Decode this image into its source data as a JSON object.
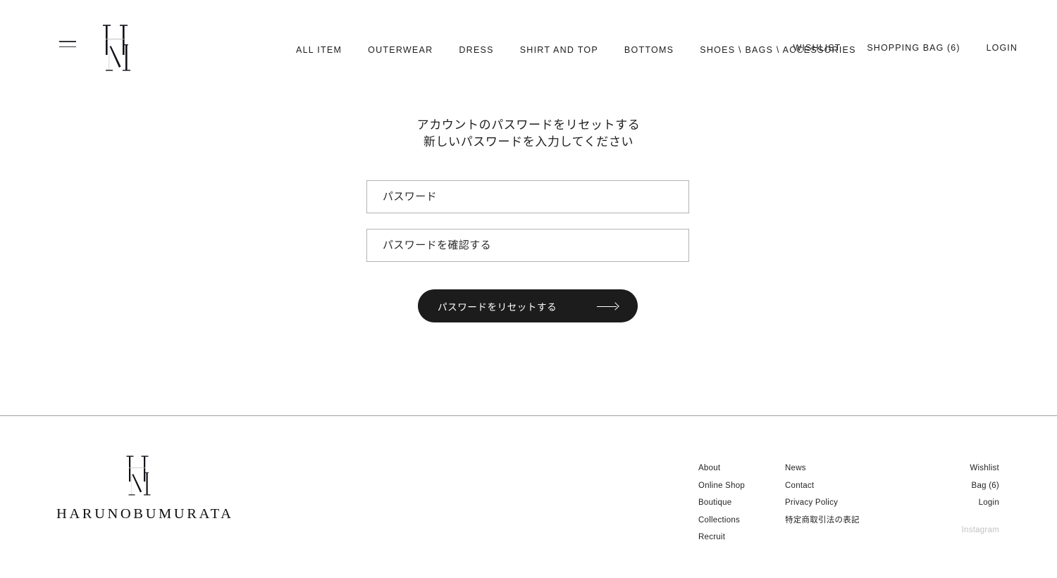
{
  "header": {
    "menu_icon": "hamburger-menu-icon",
    "logo_mark": "hm-monogram-logo",
    "nav": [
      {
        "label": "ALL ITEM",
        "name": "nav-all-item"
      },
      {
        "label": "OUTERWEAR",
        "name": "nav-outerwear"
      },
      {
        "label": "DRESS",
        "name": "nav-dress"
      },
      {
        "label": "SHIRT AND TOP",
        "name": "nav-shirt-and-top"
      },
      {
        "label": "BOTTOMS",
        "name": "nav-bottoms"
      },
      {
        "label": "SHOES \\ BAGS \\ ACCESSORIES",
        "name": "nav-shoes-bags-accessories"
      }
    ],
    "utility": [
      {
        "label": "WISHLIST",
        "name": "utility-wishlist"
      },
      {
        "label": "SHOPPING BAG (6)",
        "name": "utility-shopping-bag"
      },
      {
        "label": "LOGIN",
        "name": "utility-login"
      }
    ],
    "bag_count": "6"
  },
  "main": {
    "heading_line_1": "アカウントのパスワードをリセットする",
    "heading_line_2": "新しいパスワードを入力してください",
    "password_placeholder": "パスワード",
    "password_value": "",
    "confirm_placeholder": "パスワードを確認する",
    "confirm_value": "",
    "submit_label": "パスワードをリセットする",
    "submit_icon": "arrow-right-icon"
  },
  "footer": {
    "brand_mark": "hm-monogram-logo",
    "wordmark": "HARUNOBUMURATA",
    "column_1": [
      {
        "label": "About",
        "name": "footer-link-about"
      },
      {
        "label": "Online Shop",
        "name": "footer-link-online-shop"
      },
      {
        "label": "Boutique",
        "name": "footer-link-boutique"
      },
      {
        "label": "Collections",
        "name": "footer-link-collections"
      },
      {
        "label": "Recruit",
        "name": "footer-link-recruit"
      }
    ],
    "column_2": [
      {
        "label": "News",
        "name": "footer-link-news"
      },
      {
        "label": "Contact",
        "name": "footer-link-contact"
      },
      {
        "label": "Privacy Policy",
        "name": "footer-link-privacy-policy"
      },
      {
        "label": "特定商取引法の表記",
        "name": "footer-link-tokutei-shotorihiki"
      }
    ],
    "column_3": [
      {
        "label": "Wishlist",
        "name": "footer-link-wishlist"
      },
      {
        "label": "Bag (6)",
        "name": "footer-link-bag"
      },
      {
        "label": "Login",
        "name": "footer-link-login"
      }
    ],
    "social": {
      "label": "Instagram",
      "name": "footer-link-instagram"
    }
  },
  "colors": {
    "background": "#ffffff",
    "text": "#1c1c1c",
    "button_bg": "#1c1c1c",
    "button_text": "#ffffff",
    "field_border": "#b3b3b3",
    "divider": "#6b6b6b",
    "muted_text": "#c2c2c2"
  }
}
